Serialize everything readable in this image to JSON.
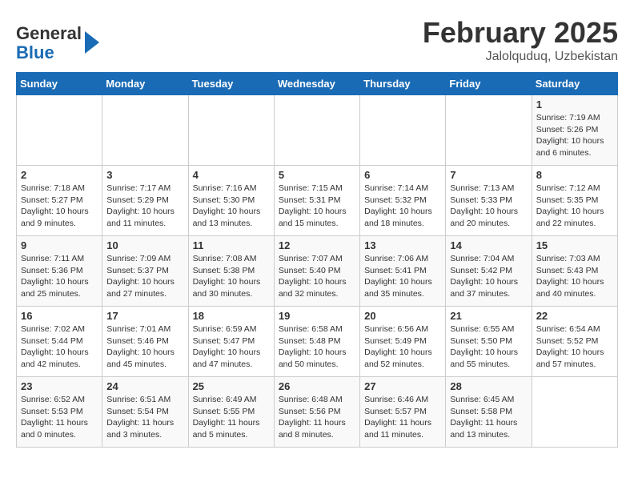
{
  "header": {
    "logo_line1": "General",
    "logo_line2": "Blue",
    "title": "February 2025",
    "subtitle": "Jalolquduq, Uzbekistan"
  },
  "weekdays": [
    "Sunday",
    "Monday",
    "Tuesday",
    "Wednesday",
    "Thursday",
    "Friday",
    "Saturday"
  ],
  "weeks": [
    [
      {
        "day": "",
        "info": ""
      },
      {
        "day": "",
        "info": ""
      },
      {
        "day": "",
        "info": ""
      },
      {
        "day": "",
        "info": ""
      },
      {
        "day": "",
        "info": ""
      },
      {
        "day": "",
        "info": ""
      },
      {
        "day": "1",
        "info": "Sunrise: 7:19 AM\nSunset: 5:26 PM\nDaylight: 10 hours\nand 6 minutes."
      }
    ],
    [
      {
        "day": "2",
        "info": "Sunrise: 7:18 AM\nSunset: 5:27 PM\nDaylight: 10 hours\nand 9 minutes."
      },
      {
        "day": "3",
        "info": "Sunrise: 7:17 AM\nSunset: 5:29 PM\nDaylight: 10 hours\nand 11 minutes."
      },
      {
        "day": "4",
        "info": "Sunrise: 7:16 AM\nSunset: 5:30 PM\nDaylight: 10 hours\nand 13 minutes."
      },
      {
        "day": "5",
        "info": "Sunrise: 7:15 AM\nSunset: 5:31 PM\nDaylight: 10 hours\nand 15 minutes."
      },
      {
        "day": "6",
        "info": "Sunrise: 7:14 AM\nSunset: 5:32 PM\nDaylight: 10 hours\nand 18 minutes."
      },
      {
        "day": "7",
        "info": "Sunrise: 7:13 AM\nSunset: 5:33 PM\nDaylight: 10 hours\nand 20 minutes."
      },
      {
        "day": "8",
        "info": "Sunrise: 7:12 AM\nSunset: 5:35 PM\nDaylight: 10 hours\nand 22 minutes."
      }
    ],
    [
      {
        "day": "9",
        "info": "Sunrise: 7:11 AM\nSunset: 5:36 PM\nDaylight: 10 hours\nand 25 minutes."
      },
      {
        "day": "10",
        "info": "Sunrise: 7:09 AM\nSunset: 5:37 PM\nDaylight: 10 hours\nand 27 minutes."
      },
      {
        "day": "11",
        "info": "Sunrise: 7:08 AM\nSunset: 5:38 PM\nDaylight: 10 hours\nand 30 minutes."
      },
      {
        "day": "12",
        "info": "Sunrise: 7:07 AM\nSunset: 5:40 PM\nDaylight: 10 hours\nand 32 minutes."
      },
      {
        "day": "13",
        "info": "Sunrise: 7:06 AM\nSunset: 5:41 PM\nDaylight: 10 hours\nand 35 minutes."
      },
      {
        "day": "14",
        "info": "Sunrise: 7:04 AM\nSunset: 5:42 PM\nDaylight: 10 hours\nand 37 minutes."
      },
      {
        "day": "15",
        "info": "Sunrise: 7:03 AM\nSunset: 5:43 PM\nDaylight: 10 hours\nand 40 minutes."
      }
    ],
    [
      {
        "day": "16",
        "info": "Sunrise: 7:02 AM\nSunset: 5:44 PM\nDaylight: 10 hours\nand 42 minutes."
      },
      {
        "day": "17",
        "info": "Sunrise: 7:01 AM\nSunset: 5:46 PM\nDaylight: 10 hours\nand 45 minutes."
      },
      {
        "day": "18",
        "info": "Sunrise: 6:59 AM\nSunset: 5:47 PM\nDaylight: 10 hours\nand 47 minutes."
      },
      {
        "day": "19",
        "info": "Sunrise: 6:58 AM\nSunset: 5:48 PM\nDaylight: 10 hours\nand 50 minutes."
      },
      {
        "day": "20",
        "info": "Sunrise: 6:56 AM\nSunset: 5:49 PM\nDaylight: 10 hours\nand 52 minutes."
      },
      {
        "day": "21",
        "info": "Sunrise: 6:55 AM\nSunset: 5:50 PM\nDaylight: 10 hours\nand 55 minutes."
      },
      {
        "day": "22",
        "info": "Sunrise: 6:54 AM\nSunset: 5:52 PM\nDaylight: 10 hours\nand 57 minutes."
      }
    ],
    [
      {
        "day": "23",
        "info": "Sunrise: 6:52 AM\nSunset: 5:53 PM\nDaylight: 11 hours\nand 0 minutes."
      },
      {
        "day": "24",
        "info": "Sunrise: 6:51 AM\nSunset: 5:54 PM\nDaylight: 11 hours\nand 3 minutes."
      },
      {
        "day": "25",
        "info": "Sunrise: 6:49 AM\nSunset: 5:55 PM\nDaylight: 11 hours\nand 5 minutes."
      },
      {
        "day": "26",
        "info": "Sunrise: 6:48 AM\nSunset: 5:56 PM\nDaylight: 11 hours\nand 8 minutes."
      },
      {
        "day": "27",
        "info": "Sunrise: 6:46 AM\nSunset: 5:57 PM\nDaylight: 11 hours\nand 11 minutes."
      },
      {
        "day": "28",
        "info": "Sunrise: 6:45 AM\nSunset: 5:58 PM\nDaylight: 11 hours\nand 13 minutes."
      },
      {
        "day": "",
        "info": ""
      }
    ]
  ]
}
